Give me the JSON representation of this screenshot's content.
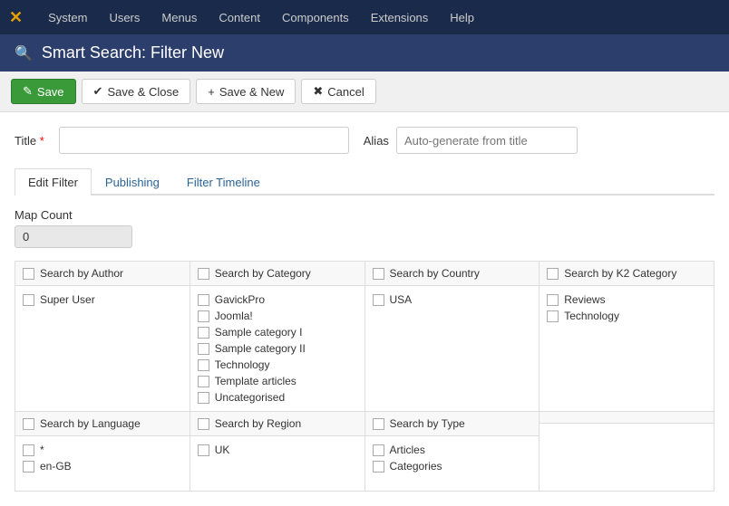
{
  "navbar": {
    "brand": "✕",
    "items": [
      "System",
      "Users",
      "Menus",
      "Content",
      "Components",
      "Extensions",
      "Help"
    ]
  },
  "page_header": {
    "icon": "🔍",
    "title": "Smart Search: Filter New"
  },
  "toolbar": {
    "save_label": "Save",
    "save_close_label": "Save & Close",
    "save_new_label": "Save & New",
    "cancel_label": "Cancel"
  },
  "form": {
    "title_label": "Title",
    "alias_label": "Alias",
    "alias_placeholder": "Auto-generate from title",
    "title_value": ""
  },
  "tabs": [
    {
      "id": "edit-filter",
      "label": "Edit Filter",
      "active": true
    },
    {
      "id": "publishing",
      "label": "Publishing",
      "active": false
    },
    {
      "id": "filter-timeline",
      "label": "Filter Timeline",
      "active": false
    }
  ],
  "map_count": {
    "label": "Map Count",
    "value": "0"
  },
  "search_columns_top": [
    {
      "header": "Search by Author",
      "items": [
        "Super User"
      ]
    },
    {
      "header": "Search by Category",
      "items": [
        "GavickPro",
        "Joomla!",
        "Sample category I",
        "Sample category II",
        "Technology",
        "Template articles",
        "Uncategorised"
      ]
    },
    {
      "header": "Search by Country",
      "items": [
        "USA"
      ]
    },
    {
      "header": "Search by K2 Category",
      "items": [
        "Reviews",
        "Technology"
      ]
    }
  ],
  "search_columns_bottom": [
    {
      "header": "Search by Language",
      "items": [
        "*",
        "en-GB"
      ]
    },
    {
      "header": "Search by Region",
      "items": [
        "UK"
      ]
    },
    {
      "header": "Search by Type",
      "items": [
        "Articles",
        "Categories"
      ]
    },
    {
      "header": "",
      "items": []
    }
  ]
}
